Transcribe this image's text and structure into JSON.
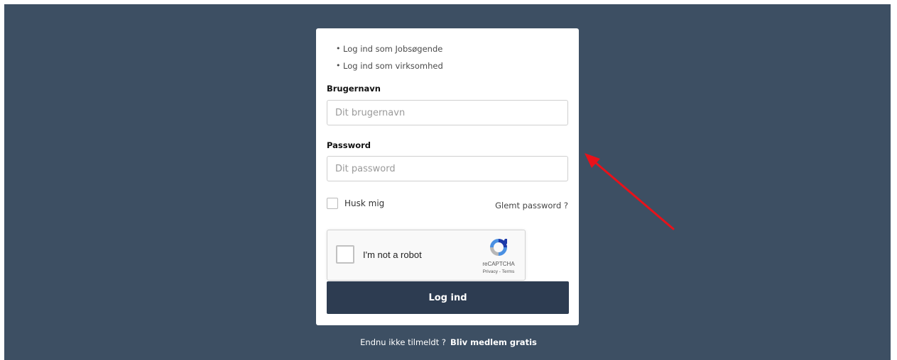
{
  "login_links": [
    {
      "label": "Log ind som Jobsøgende"
    },
    {
      "label": "Log ind som virksomhed"
    }
  ],
  "username": {
    "label": "Brugernavn",
    "placeholder": "Dit brugernavn"
  },
  "password": {
    "label": "Password",
    "placeholder": "Dit password"
  },
  "remember": {
    "label": "Husk mig"
  },
  "forgot": {
    "label": "Glemt password ?"
  },
  "recaptcha": {
    "label": "I'm not a robot",
    "brand": "reCAPTCHA",
    "links": "Privacy - Terms"
  },
  "submit": {
    "label": "Log ind"
  },
  "signup": {
    "prompt": "Endnu ikke tilmeldt ?",
    "cta": "Bliv medlem gratis"
  },
  "colors": {
    "background": "#3d4f63",
    "button": "#2d3c51",
    "arrow": "#e8121a"
  },
  "icons": {
    "annotation": "red-arrow-icon",
    "captcha": "recaptcha-logo-icon"
  }
}
